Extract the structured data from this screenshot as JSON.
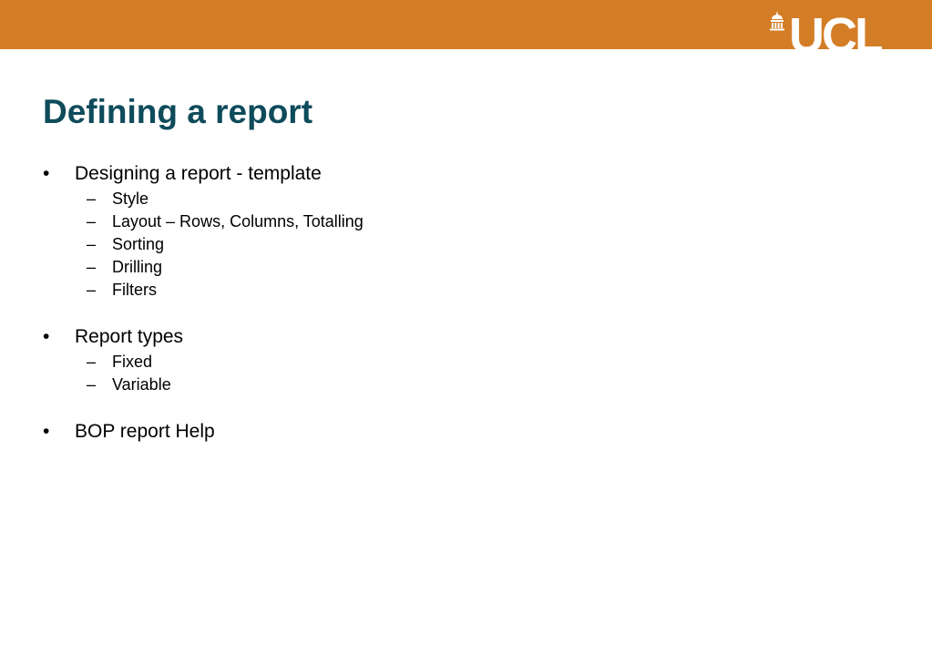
{
  "header": {
    "brand_color": "#d47d27",
    "logo_text": "UCL"
  },
  "title": "Defining a report",
  "title_color": "#0e4b5b",
  "bullets": [
    {
      "text": "Designing a report - template",
      "subitems": [
        "Style",
        "Layout – Rows, Columns, Totalling",
        "Sorting",
        "Drilling",
        "Filters"
      ]
    },
    {
      "text": "Report types",
      "subitems": [
        "Fixed",
        "Variable"
      ]
    },
    {
      "text": "BOP report Help",
      "subitems": []
    }
  ],
  "markers": {
    "level1": "•",
    "level2": "–"
  }
}
